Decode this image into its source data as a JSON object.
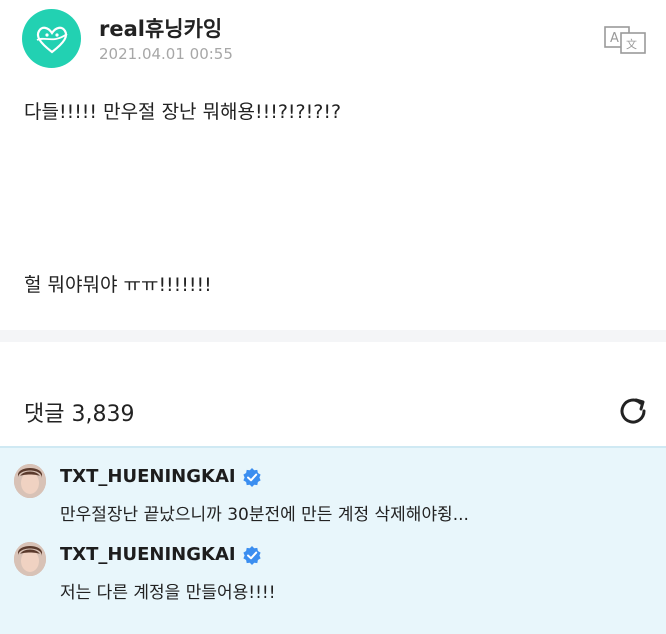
{
  "post": {
    "author": "real휴닝카잉",
    "date": "2021.04.01 00:55",
    "lines": [
      "다들!!!!! 만우절 장난 뭐해용!!!?!?!?!?",
      "헐 뭐야뭐야 ㅠㅠ!!!!!!!"
    ]
  },
  "comments": {
    "title": "댓글 3,839",
    "items": [
      {
        "name": "TXT_HUENINGKAI",
        "text": "만우절장난 끝났으니까 30분전에 만든 계정 삭제해야쥥..."
      },
      {
        "name": "TXT_HUENINGKAI",
        "text": "저는 다른 계정을 만들어용!!!!"
      }
    ]
  },
  "colors": {
    "accent": "#22d1b2",
    "verified": "#3b8ef0",
    "pinned_bg": "#e8f6fb"
  },
  "icons": {
    "translate": "translate-icon",
    "refresh": "refresh-icon",
    "verified": "verified-badge-icon"
  }
}
